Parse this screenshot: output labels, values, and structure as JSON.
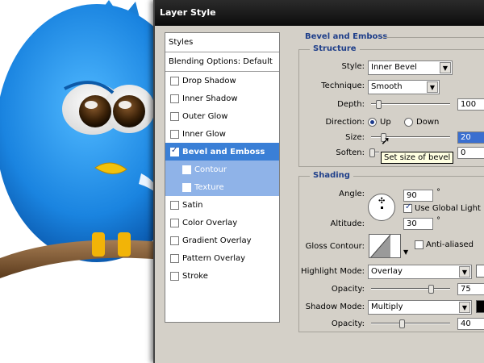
{
  "dialog": {
    "title": "Layer Style"
  },
  "styles_list": {
    "header": "Styles",
    "blending": "Blending Options: Default",
    "items": [
      {
        "label": "Drop Shadow",
        "checked": false
      },
      {
        "label": "Inner Shadow",
        "checked": false
      },
      {
        "label": "Outer Glow",
        "checked": false
      },
      {
        "label": "Inner Glow",
        "checked": false
      },
      {
        "label": "Bevel and Emboss",
        "checked": true
      },
      {
        "label": "Contour",
        "checked": false
      },
      {
        "label": "Texture",
        "checked": false
      },
      {
        "label": "Satin",
        "checked": false
      },
      {
        "label": "Color Overlay",
        "checked": false
      },
      {
        "label": "Gradient Overlay",
        "checked": false
      },
      {
        "label": "Pattern Overlay",
        "checked": false
      },
      {
        "label": "Stroke",
        "checked": false
      }
    ]
  },
  "bevel": {
    "title": "Bevel and Emboss",
    "structure": {
      "legend": "Structure",
      "style_label": "Style:",
      "style_value": "Inner Bevel",
      "technique_label": "Technique:",
      "technique_value": "Smooth",
      "depth_label": "Depth:",
      "depth_value": "100",
      "depth_level": 0.05,
      "direction_label": "Direction:",
      "direction_up": "Up",
      "direction_down": "Down",
      "size_label": "Size:",
      "size_value": "20",
      "soften_label": "Soften:",
      "soften_value": "0",
      "tooltip": "Set size of bevel"
    },
    "shading": {
      "legend": "Shading",
      "angle_label": "Angle:",
      "angle_value": "90",
      "degree": "°",
      "global_light": "Use Global Light",
      "altitude_label": "Altitude:",
      "altitude_value": "30",
      "gloss_label": "Gloss Contour:",
      "anti_aliased": "Anti-aliased",
      "highlight_mode_label": "Highlight Mode:",
      "highlight_mode_value": "Overlay",
      "highlight_opacity_label": "Opacity:",
      "highlight_opacity_value": "75",
      "shadow_mode_label": "Shadow Mode:",
      "shadow_mode_value": "Multiply",
      "shadow_opacity_label": "Opacity:",
      "shadow_opacity_value": "40"
    }
  },
  "colors": {
    "selected_row": "#3a7fd6",
    "sub_row": "#8fb3e8",
    "bird_blue": "#1e88e0",
    "highlight_swatch": "#ffffff",
    "shadow_swatch": "#000000"
  }
}
